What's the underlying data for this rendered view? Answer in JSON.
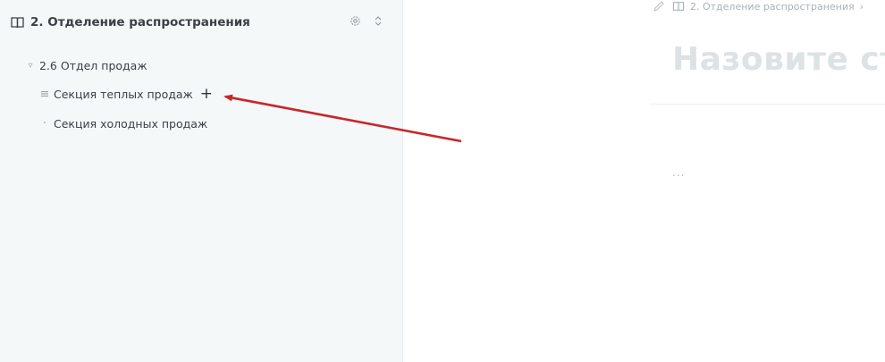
{
  "sidebar": {
    "title": "2. Отделение распространения",
    "icons": {
      "book": "book-icon",
      "settings": "gear-icon",
      "expand": "chevron-updown-icon"
    },
    "tree": [
      {
        "label": "2.6 Отдел продаж",
        "marker": "▿"
      },
      {
        "label": "Секция теплых продаж",
        "marker": "≡",
        "action": "+"
      },
      {
        "label": "Секция холодных продаж",
        "marker": "·"
      }
    ]
  },
  "annotation": {
    "arrow_color": "#c9262a"
  },
  "main": {
    "breadcrumb": {
      "item": "2. Отделение распространения",
      "separator": "›"
    },
    "title_placeholder": "Назовите ст",
    "body_placeholder": "..."
  }
}
